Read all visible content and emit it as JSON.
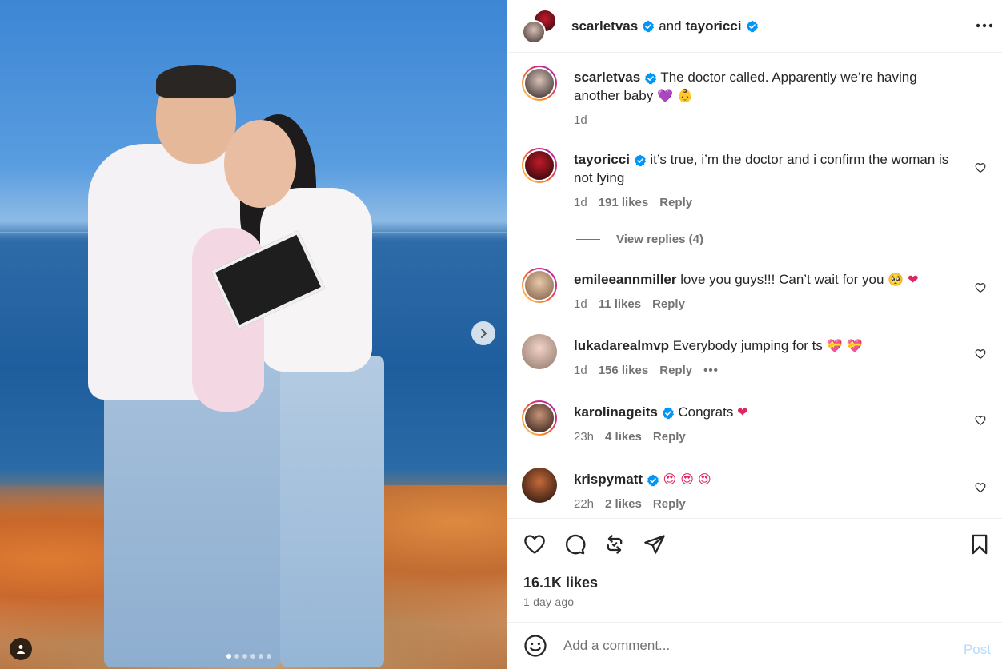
{
  "header": {
    "user1": "scarletvas",
    "joiner": "and",
    "user2": "tayoricci"
  },
  "caption": {
    "username": "scarletvas",
    "text": "The doctor called. Apparently we’re having another baby",
    "emoji": "💜 👶",
    "time": "1d"
  },
  "comments": [
    {
      "username": "tayoricci",
      "verified": true,
      "text": "it’s true, i’m the doctor and i confirm the woman is not lying",
      "time": "1d",
      "likes": "191 likes",
      "reply": "Reply"
    },
    {
      "username": "emileeannmiller",
      "verified": false,
      "text": "love you guys!!! Can’t wait for you",
      "emoji": "🥺 ❤",
      "time": "1d",
      "likes": "11 likes",
      "reply": "Reply"
    },
    {
      "username": "lukadarealmvp",
      "verified": false,
      "text": "Everybody jumping for ts",
      "emoji": "💝 💝",
      "time": "1d",
      "likes": "156 likes",
      "reply": "Reply",
      "more": "•••"
    },
    {
      "username": "karolinageits",
      "verified": true,
      "text": "Congrats",
      "emoji": "❤",
      "time": "23h",
      "likes": "4 likes",
      "reply": "Reply"
    },
    {
      "username": "krispymatt",
      "verified": true,
      "text": "",
      "emoji": "😍 😍 😍",
      "time": "22h",
      "likes": "2 likes",
      "reply": "Reply"
    }
  ],
  "view_replies": "View replies (4)",
  "stats": {
    "likes": "16.1K likes",
    "ago": "1 day ago"
  },
  "composer": {
    "placeholder": "Add a comment...",
    "post_label": "Post"
  },
  "icons": {
    "like": "heart-icon",
    "comment": "comment-icon",
    "repost": "repost-icon",
    "share": "send-icon",
    "save": "bookmark-icon",
    "emoji": "smiley-icon",
    "next": "chevron-right-icon",
    "tag": "user-tag-icon",
    "more": "more-horizontal-icon"
  },
  "colors": {
    "verified": "#0095f6",
    "post_disabled": "#b3dbff",
    "muted": "#737373",
    "text": "#262626"
  },
  "carousel": {
    "slide_count": 6,
    "active_index": 0
  }
}
